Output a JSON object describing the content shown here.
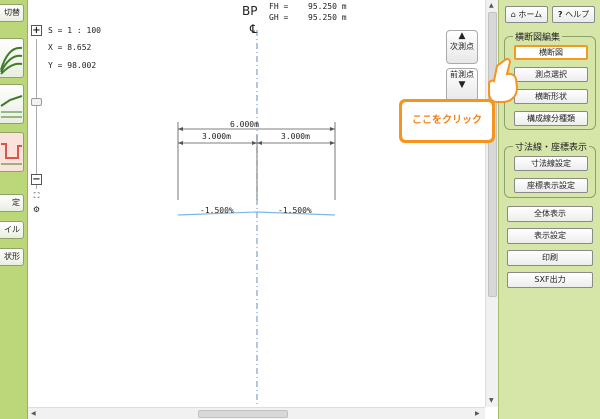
{
  "left_toolbar": {
    "items": [
      {
        "label": "切替"
      },
      {
        "label": "",
        "icon": "plan-view-icon"
      },
      {
        "label": "",
        "icon": "profile-view-icon"
      },
      {
        "label": "",
        "icon": "cross-section-icon"
      },
      {
        "label": "定"
      },
      {
        "label": "イル"
      },
      {
        "label": "状形"
      }
    ]
  },
  "zoom": {
    "plus": "+",
    "minus": "−",
    "fit": "⛶",
    "settings": "⚙"
  },
  "readout": {
    "scale": "S = 1 : 100",
    "x": "X = 8.652",
    "y": "Y = 98.002"
  },
  "header": {
    "bp": "BP",
    "cl": "℄",
    "fh_label": "FH =",
    "fh_value": "95.250 m",
    "gh_label": "GH =",
    "gh_value": "95.250 m"
  },
  "nav": {
    "next_label": "次測点",
    "prev_label": "前測点"
  },
  "drawing": {
    "total_width": "6.000m",
    "left_width": "3.000m",
    "right_width": "3.000m",
    "left_slope": "-1.500%",
    "right_slope": "-1.500%"
  },
  "right_panel": {
    "home_label": "ホーム",
    "help_label": "ヘルプ",
    "group1": {
      "title": "横断図編集",
      "buttons": [
        "横断図",
        "測点選択",
        "横断形状",
        "構成線分種類"
      ]
    },
    "group2": {
      "title": "寸法線・座標表示",
      "buttons": [
        "寸法線設定",
        "座標表示設定"
      ]
    },
    "standalone": [
      "全体表示",
      "表示設定",
      "印刷",
      "SXF出力"
    ]
  },
  "callout": {
    "text": "ここをクリック"
  },
  "colors": {
    "accent": "#f5941e",
    "panel": "#d6e6a9",
    "strip": "#bcd67a",
    "road": "#7fb6e6"
  }
}
